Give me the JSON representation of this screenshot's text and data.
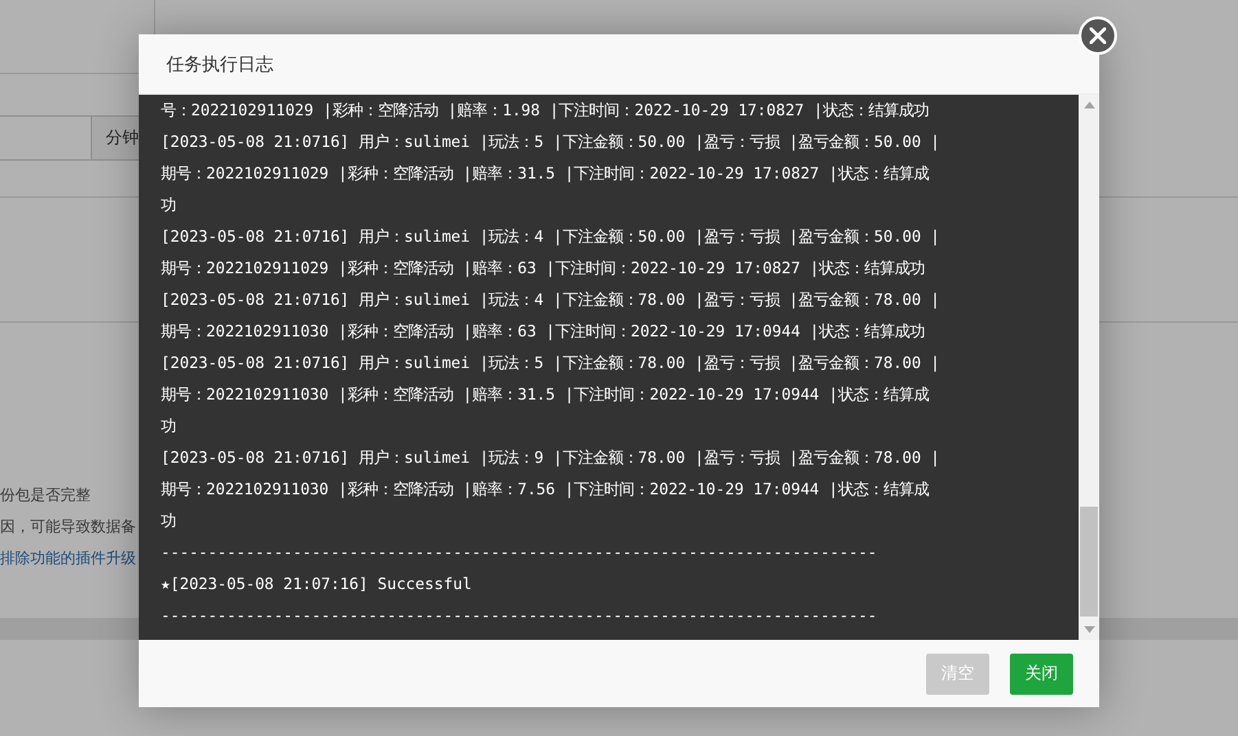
{
  "background": {
    "unit_button": "分钟",
    "notes": [
      "份包是否完整",
      "因，可能导致数据备",
      "排除功能的插件升级"
    ]
  },
  "dialog": {
    "title": "任务执行日志",
    "log_lines": [
      "号：2022102911029 |彩种：空降活动 |赔率：1.98 |下注时间：2022-10-29 17:0827 |状态：结算成功",
      "[2023-05-08 21:0716] 用户：sulimei |玩法：5 |下注金额：50.00 |盈亏：亏损 |盈亏金额：50.00 |",
      "期号：2022102911029 |彩种：空降活动 |赔率：31.5 |下注时间：2022-10-29 17:0827 |状态：结算成",
      "功",
      "[2023-05-08 21:0716] 用户：sulimei |玩法：4 |下注金额：50.00 |盈亏：亏损 |盈亏金额：50.00 |",
      "期号：2022102911029 |彩种：空降活动 |赔率：63 |下注时间：2022-10-29 17:0827 |状态：结算成功",
      "[2023-05-08 21:0716] 用户：sulimei |玩法：4 |下注金额：78.00 |盈亏：亏损 |盈亏金额：78.00 |",
      "期号：2022102911030 |彩种：空降活动 |赔率：63 |下注时间：2022-10-29 17:0944 |状态：结算成功",
      "[2023-05-08 21:0716] 用户：sulimei |玩法：5 |下注金额：78.00 |盈亏：亏损 |盈亏金额：78.00 |",
      "期号：2022102911030 |彩种：空降活动 |赔率：31.5 |下注时间：2022-10-29 17:0944 |状态：结算成",
      "功",
      "[2023-05-08 21:0716] 用户：sulimei |玩法：9 |下注金额：78.00 |盈亏：亏损 |盈亏金额：78.00 |",
      "期号：2022102911030 |彩种：空降活动 |赔率：7.56 |下注时间：2022-10-29 17:0944 |状态：结算成",
      "功",
      "----------------------------------------------------------------------------",
      "★[2023-05-08 21:07:16] Successful",
      "----------------------------------------------------------------------------"
    ],
    "buttons": [
      {
        "label": "清空",
        "kind": "secondary"
      },
      {
        "label": "关闭",
        "kind": "primary"
      }
    ]
  }
}
